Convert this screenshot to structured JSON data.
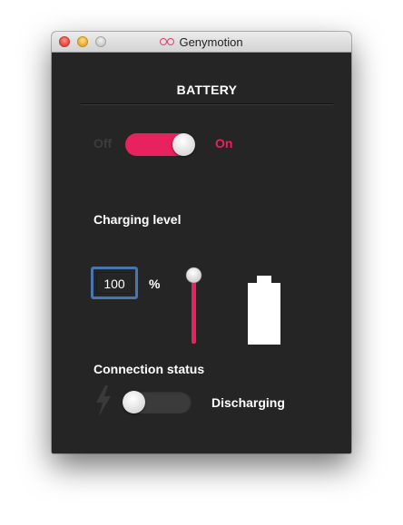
{
  "window": {
    "title": "Genymotion"
  },
  "battery": {
    "section_title": "BATTERY",
    "power_toggle": {
      "off_label": "Off",
      "on_label": "On",
      "state": "on",
      "color": "#e8215f"
    },
    "charging": {
      "label": "Charging level",
      "value": "100",
      "unit": "%",
      "slider_level_percent": 100,
      "battery_fill_percent": 100
    },
    "connection": {
      "label": "Connection status",
      "toggle_state": "off",
      "status": "Discharging",
      "icon": "lightning-bolt-icon"
    }
  },
  "colors": {
    "accent": "#e8215f",
    "background": "#252525",
    "input_border": "#4a76b0"
  }
}
